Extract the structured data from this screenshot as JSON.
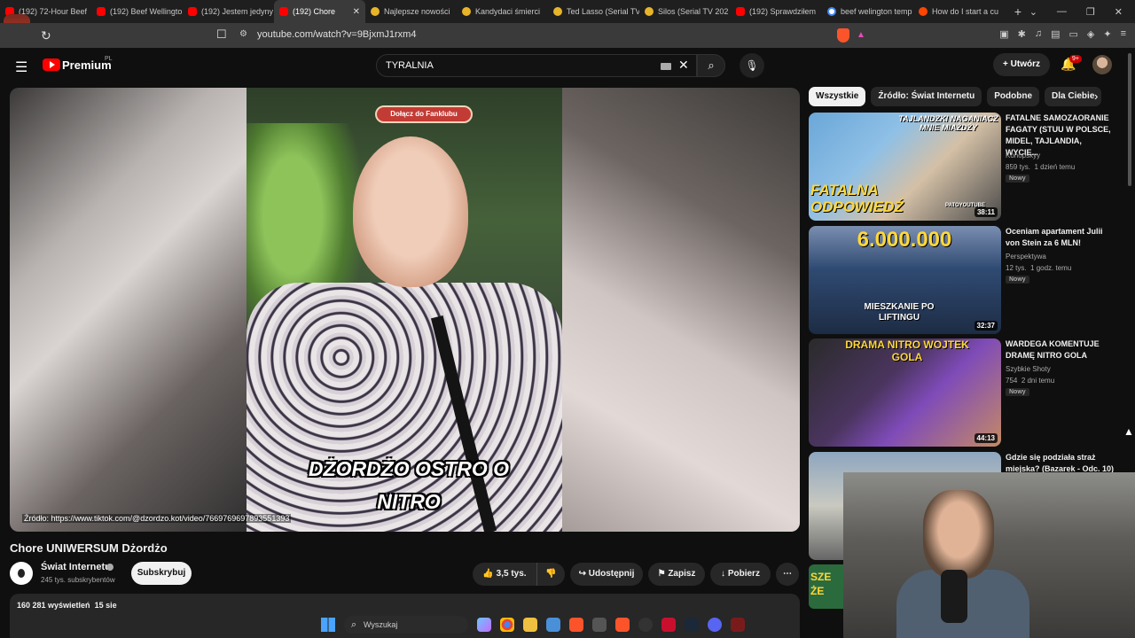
{
  "browser": {
    "tabs": [
      {
        "title": "(192) 72-Hour Beef",
        "icon": "youtube"
      },
      {
        "title": "(192) Beef Wellington",
        "icon": "youtube"
      },
      {
        "title": "(192) Jestem jedyny",
        "icon": "youtube"
      },
      {
        "title": "(192) Chore",
        "icon": "youtube",
        "active": true
      },
      {
        "title": "Najlepsze nowości",
        "icon": "filmweb"
      },
      {
        "title": "Kandydaci śmierci",
        "icon": "filmweb"
      },
      {
        "title": "Ted Lasso (Serial TV",
        "icon": "filmweb"
      },
      {
        "title": "Silos (Serial TV 202",
        "icon": "filmweb"
      },
      {
        "title": "(192) Sprawdziłem",
        "icon": "youtube"
      },
      {
        "title": "beef welington temp",
        "icon": "google"
      },
      {
        "title": "How do I start a cu",
        "icon": "reddit"
      }
    ],
    "url": "youtube.com/watch?v=9BjxmJ1rxm4",
    "badge": "x6"
  },
  "header": {
    "brand": "Premium",
    "country": "PL",
    "search_value": "TYRALNIA",
    "create_label": "Utwórz",
    "notifications": "9+"
  },
  "video": {
    "fan_button": "Dołącz do Fanklubu",
    "caption": "DŻORDŻO OSTRO O NITRO",
    "source_label": "Źródło:",
    "source_url": "https://www.tiktok.com/@dzordzo.kot/video/7669769697893551393",
    "title": "Chore UNIWERSUM Dżordżo",
    "channel": "Świat Internetu",
    "subscribers": "245 tys. subskrybentów",
    "subscribe": "Subskrybuj",
    "likes": "3,5 tys.",
    "share": "Udostępnij",
    "save": "Zapisz",
    "download": "Pobierz",
    "views": "160 281 wyświetleń",
    "date": "15 sie"
  },
  "chips": [
    "Wszystkie",
    "Źródło: Świat Internetu",
    "Podobne",
    "Dla Ciebie"
  ],
  "recommendations": [
    {
      "title": "FATALNE SAMOZAORANIE FAGATY (STUU W POLSCE, MIDEL, TAJLANDIA, WYCIE...",
      "channel": "Konopskyy",
      "views": "859 tys.",
      "age": "1 dzień temu",
      "badge": "Nowy",
      "duration": "38:11",
      "thumb_text_top": "TAJLANDZKI NAGANIACZ MNIE MIAŻDŻY",
      "thumb_text_bottom": "FATALNA ODPOWIEDŹ",
      "thumb_small": "PATOYOUTUBE"
    },
    {
      "title": "Oceniam apartament Julii von Stein za 6 MLN!",
      "channel": "Perspektywa",
      "views": "12 tys.",
      "age": "1 godz. temu",
      "badge": "Nowy",
      "duration": "32:37",
      "thumb_text_top": "6.000.000",
      "thumb_text_bottom": "MIESZKANIE PO LIFTINGU"
    },
    {
      "title": "WARDEGA KOMENTUJE DRAMĘ NITRO GOLA",
      "channel": "Szybkie Shoty",
      "views": "754",
      "age": "2 dni temu",
      "badge": "Nowy",
      "duration": "44:13",
      "thumb_text_top": "DRAMA NITRO WOJTEK GOLA"
    },
    {
      "title": "Gdzie się podziała straż miejska? (Bazarek - Odc. 10)",
      "channel": "",
      "views": "",
      "age": "",
      "badge": "",
      "duration": ""
    }
  ],
  "partial_thumb_text": "SZE ŻE",
  "taskbar": {
    "search_placeholder": "Wyszukaj"
  },
  "colors": {
    "accent": "#ff0000",
    "bg": "#0f0f0f",
    "chip_active": "#f1f1f1"
  }
}
